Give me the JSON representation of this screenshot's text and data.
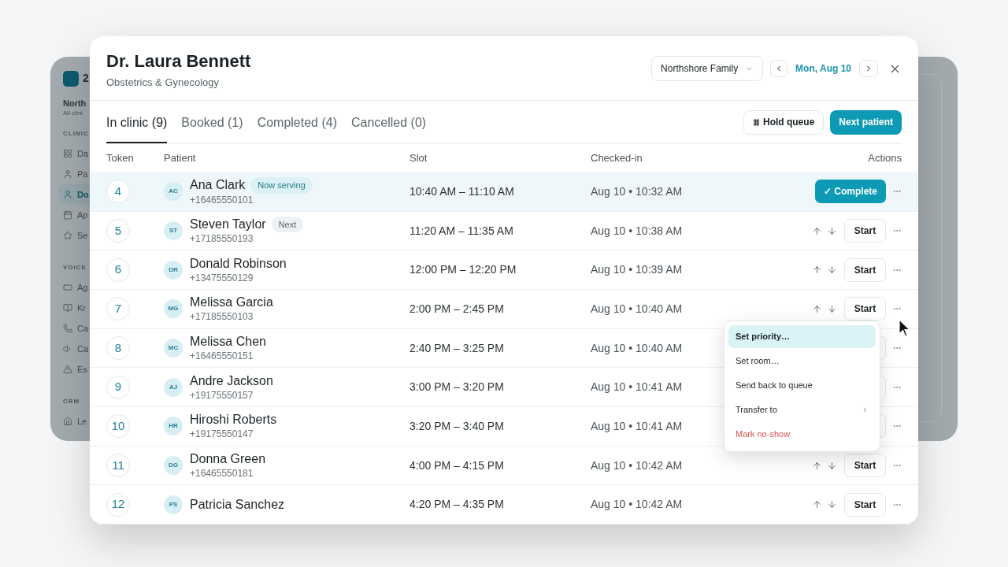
{
  "background_app": {
    "logo_text": "2",
    "org_name": "North",
    "org_sub": "All clini",
    "sections": [
      {
        "title": "CLINIC",
        "items": [
          {
            "label": "Da",
            "selected": false
          },
          {
            "label": "Pa",
            "selected": false
          },
          {
            "label": "Do",
            "selected": true
          },
          {
            "label": "Ap",
            "selected": false
          },
          {
            "label": "Se",
            "selected": false
          }
        ]
      },
      {
        "title": "VOICE",
        "items": [
          {
            "label": "Ag",
            "selected": false
          },
          {
            "label": "Kr",
            "selected": false
          },
          {
            "label": "Ca",
            "selected": false
          },
          {
            "label": "Ca",
            "selected": false
          },
          {
            "label": "Es",
            "selected": false
          }
        ]
      },
      {
        "title": "CRM",
        "items": [
          {
            "label": "Le",
            "selected": false
          }
        ]
      }
    ]
  },
  "modal": {
    "title": "Dr. Laura Bennett",
    "subtitle": "Obstetrics & Gynecology",
    "clinic_select": "Northshore Family",
    "date": "Mon, Aug 10",
    "tabs": [
      {
        "label": "In clinic (9)",
        "selected": true
      },
      {
        "label": "Booked (1)",
        "selected": false
      },
      {
        "label": "Completed (4)",
        "selected": false
      },
      {
        "label": "Cancelled (0)",
        "selected": false
      }
    ],
    "buttons": [
      {
        "kind": "secondary",
        "label": "Hold queue"
      },
      {
        "kind": "primary",
        "label": "Next patient"
      }
    ],
    "table": {
      "columns": [
        "Token",
        "Patient",
        "Slot",
        "Checked-in",
        "Actions"
      ],
      "rows": [
        {
          "kind": "serving",
          "token": "4",
          "initials": "AC",
          "name": "Ana Clark",
          "phone": "+16465550101",
          "badge": {
            "kind": "serving",
            "label": "Now serving"
          },
          "slot": "10:40 AM – 11:10 AM",
          "checked_in": "Aug 10 • 10:32 AM",
          "action": {
            "kind": "complete",
            "label": "✓ Complete"
          }
        },
        {
          "kind": "waiting",
          "token": "5",
          "initials": "ST",
          "name": "Steven Taylor",
          "phone": "+17185550193",
          "badge": {
            "kind": "next",
            "label": "Next"
          },
          "slot": "11:20 AM – 11:35 AM",
          "checked_in": "Aug 10 • 10:38 AM",
          "action": {
            "kind": "start",
            "label": "Start"
          }
        },
        {
          "kind": "waiting",
          "token": "6",
          "initials": "DR",
          "name": "Donald Robinson",
          "phone": "+13475550129",
          "slot": "12:00 PM – 12:20 PM",
          "checked_in": "Aug 10 • 10:39 AM",
          "action": {
            "kind": "start",
            "label": "Start"
          }
        },
        {
          "kind": "waiting",
          "token": "7",
          "initials": "MG",
          "name": "Melissa Garcia",
          "phone": "+17185550103",
          "slot": "2:00 PM – 2:45 PM",
          "checked_in": "Aug 10 • 10:40 AM",
          "action": {
            "kind": "start",
            "label": "Start"
          }
        },
        {
          "kind": "waiting",
          "token": "8",
          "initials": "MC",
          "name": "Melissa Chen",
          "phone": "+16465550151",
          "slot": "2:40 PM – 3:25 PM",
          "checked_in": "Aug 10 • 10:40 AM",
          "action": {
            "kind": "covered"
          }
        },
        {
          "kind": "waiting",
          "token": "9",
          "initials": "AJ",
          "name": "Andre Jackson",
          "phone": "+19175550157",
          "slot": "3:00 PM – 3:20 PM",
          "checked_in": "Aug 10 • 10:41 AM",
          "action": {
            "kind": "covered"
          }
        },
        {
          "kind": "waiting",
          "token": "10",
          "initials": "HR",
          "name": "Hiroshi Roberts",
          "phone": "+19175550147",
          "slot": "3:20 PM – 3:40 PM",
          "checked_in": "Aug 10 • 10:41 AM",
          "action": {
            "kind": "covered"
          }
        },
        {
          "kind": "waiting",
          "token": "11",
          "initials": "DG",
          "name": "Donna Green",
          "phone": "+16465550181",
          "slot": "4:00 PM – 4:15 PM",
          "checked_in": "Aug 10 • 10:42 AM",
          "action": {
            "kind": "start",
            "label": "Start"
          }
        },
        {
          "kind": "waiting",
          "token": "12",
          "initials": "PS",
          "name": "Patricia Sanchez",
          "slot": "4:20 PM – 4:35 PM",
          "checked_in": "Aug 10 • 10:42 AM",
          "action": {
            "kind": "start",
            "label": "Start"
          }
        }
      ]
    },
    "menu": {
      "items": [
        {
          "kind": "normal",
          "label": "Set priority…",
          "selected": true
        },
        {
          "kind": "normal",
          "label": "Set room…",
          "selected": false
        },
        {
          "kind": "normal",
          "label": "Send back to queue",
          "selected": false
        },
        {
          "kind": "submenu",
          "label": "Transfer to",
          "selected": false
        },
        {
          "kind": "danger",
          "label": "Mark no-show",
          "selected": false
        }
      ]
    }
  }
}
